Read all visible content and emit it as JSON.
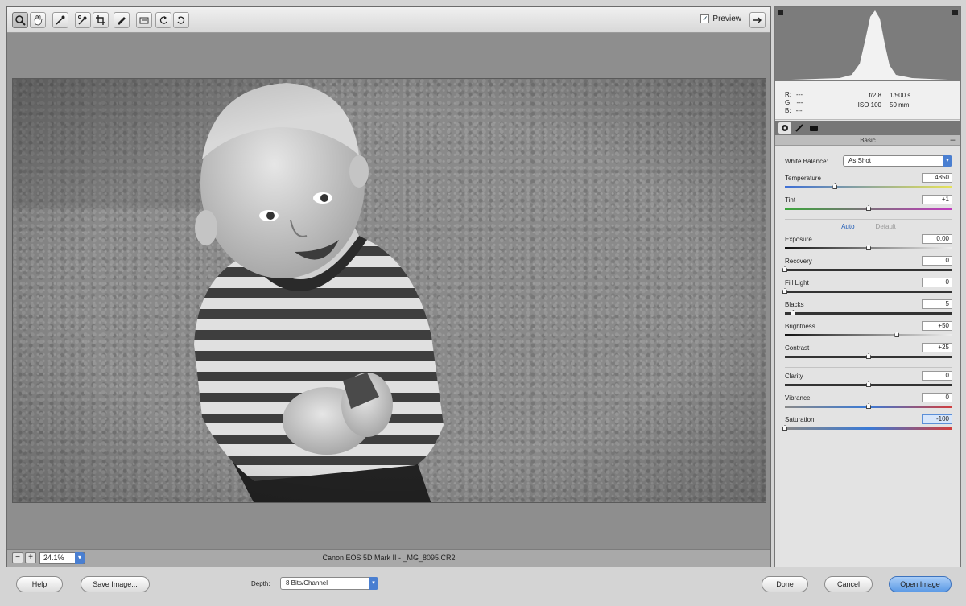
{
  "toolbar": {
    "tools": [
      {
        "name": "zoom-tool-icon",
        "active": true
      },
      {
        "name": "hand-tool-icon",
        "active": false
      },
      {
        "name": "eyedropper-tool-icon",
        "active": false
      },
      {
        "name": "color-sampler-tool-icon",
        "active": false
      },
      {
        "name": "crop-tool-icon",
        "active": false
      },
      {
        "name": "straighten-tool-icon",
        "active": false
      },
      {
        "name": "preferences-icon",
        "active": false
      },
      {
        "name": "rotate-left-icon",
        "active": false
      },
      {
        "name": "rotate-right-icon",
        "active": false
      }
    ],
    "preview_label": "Preview",
    "preview_checked": true
  },
  "canvas": {
    "photo_subject": "black-and-white photo of a smiling toddler in a striped shirt on gravel"
  },
  "status_bar": {
    "zoom_value": "24.1%",
    "file_info": "Canon EOS 5D Mark II  -  _MG_8095.CR2"
  },
  "histogram": {
    "icon_left": "shadow-clipping-icon",
    "icon_right": "highlight-clipping-icon"
  },
  "readout": {
    "r": "R:",
    "g": "G:",
    "b": "B:",
    "dash": "---",
    "aperture": "f/2.8",
    "shutter": "1/500 s",
    "iso": "ISO 100",
    "focal": "50 mm"
  },
  "panel": {
    "tab_icons": [
      "basic-panel-icon",
      "tone-curve-icon",
      "camera-calibration-icon"
    ],
    "title": "Basic",
    "white_balance_label": "White Balance:",
    "white_balance_value": "As Shot",
    "auto_label": "Auto",
    "default_label": "Default",
    "sliders": [
      {
        "key": "temperature",
        "label": "Temperature",
        "value": "4850",
        "position": 0.3,
        "track": "temp"
      },
      {
        "key": "tint",
        "label": "Tint",
        "value": "+1",
        "position": 0.5,
        "track": "tint"
      },
      {
        "key": "sep1",
        "separator": "auto"
      },
      {
        "key": "exposure",
        "label": "Exposure",
        "value": "0.00",
        "position": 0.5
      },
      {
        "key": "recovery",
        "label": "Recovery",
        "value": "0",
        "position": 0.0
      },
      {
        "key": "fill_light",
        "label": "Fill Light",
        "value": "0",
        "position": 0.0
      },
      {
        "key": "blacks",
        "label": "Blacks",
        "value": "5",
        "position": 0.05
      },
      {
        "key": "brightness",
        "label": "Brightness",
        "value": "+50",
        "position": 0.67
      },
      {
        "key": "contrast",
        "label": "Contrast",
        "value": "+25",
        "position": 0.5
      },
      {
        "key": "sep2",
        "separator": "line"
      },
      {
        "key": "clarity",
        "label": "Clarity",
        "value": "0",
        "position": 0.5
      },
      {
        "key": "vibrance",
        "label": "Vibrance",
        "value": "0",
        "position": 0.5
      },
      {
        "key": "saturation",
        "label": "Saturation",
        "value": "-100",
        "position": 0.0,
        "highlight": true
      }
    ]
  },
  "bottom": {
    "help_label": "Help",
    "save_label": "Save Image...",
    "depth_label": "Depth:",
    "depth_value": "8 Bits/Channel",
    "done_label": "Done",
    "cancel_label": "Cancel",
    "open_label": "Open Image"
  },
  "colors": {
    "accent": "#4a7fd1",
    "primary_button": "#5d9be6"
  }
}
